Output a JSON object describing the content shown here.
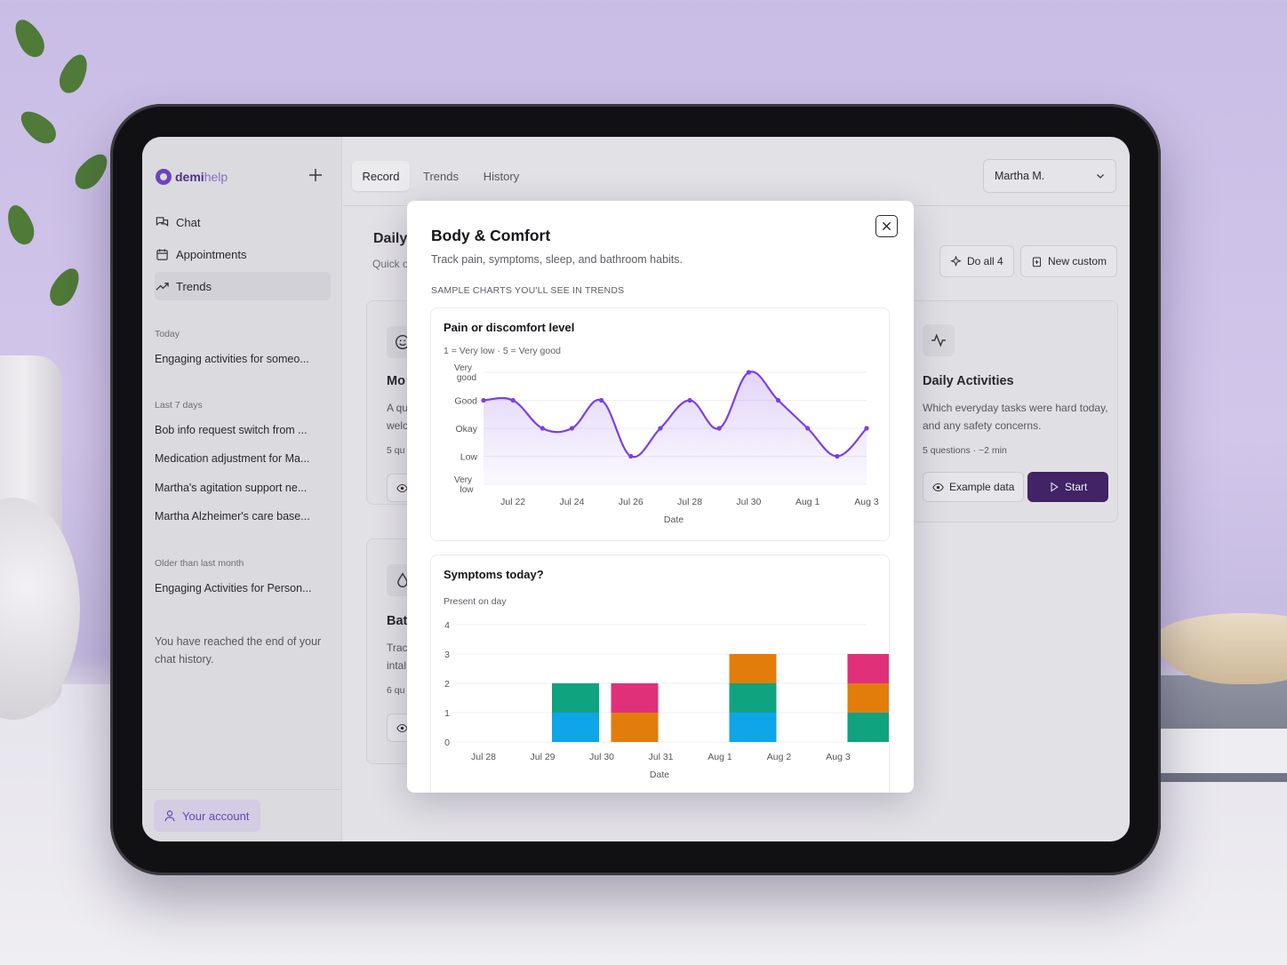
{
  "app": {
    "logo_main": "demi",
    "logo_accent": "help"
  },
  "sidebar": {
    "nav": [
      {
        "label": "Chat",
        "icon": "chat-icon"
      },
      {
        "label": "Appointments",
        "icon": "calendar-icon"
      },
      {
        "label": "Trends",
        "icon": "trend-icon"
      }
    ],
    "sections": [
      {
        "label": "Today",
        "items": [
          "Engaging activities for someo..."
        ]
      },
      {
        "label": "Last 7 days",
        "items": [
          "Bob info request switch from ...",
          "Medication adjustment for Ma...",
          "Martha's agitation support ne...",
          "Martha Alzheimer's care base..."
        ]
      },
      {
        "label": "Older than last month",
        "items": [
          "Engaging Activities for Person..."
        ]
      }
    ],
    "end_note": "You have reached the end of your chat history.",
    "account_label": "Your account"
  },
  "topbar": {
    "tabs": [
      "Record",
      "Trends",
      "History"
    ],
    "active_tab": "Record",
    "user": "Martha M."
  },
  "main": {
    "title_partial": "Daily",
    "subtitle_partial": "Quick o",
    "do_all_label": "Do all 4",
    "new_custom_label": "New custom",
    "cards": {
      "left_top_title": "Mo",
      "left_top_desc": [
        "A qu",
        "welc"
      ],
      "left_top_meta": "5 qu",
      "left_bottom_title": "Bat",
      "left_bottom_desc": [
        "Trac",
        "intal"
      ],
      "left_bottom_meta": "6 qu",
      "daily_activities": {
        "title": "Daily Activities",
        "desc": "Which everyday tasks were hard today, and any safety concerns.",
        "meta": "5 questions · ~2 min",
        "example_label": "Example data",
        "start_label": "Start"
      }
    }
  },
  "modal": {
    "title": "Body & Comfort",
    "subtitle": "Track pain, symptoms, sleep, and bathroom habits.",
    "section_label": "SAMPLE CHARTS YOU'LL SEE IN TRENDS"
  },
  "chart_data": [
    {
      "type": "line",
      "title": "Pain or discomfort level",
      "subtitle": "1 = Very low · 5 = Very good",
      "xlabel": "Date",
      "ylabel": "",
      "ylim": [
        1,
        5
      ],
      "y_tick_labels": [
        {
          "value": 5,
          "label": "Very good"
        },
        {
          "value": 4,
          "label": "Good"
        },
        {
          "value": 3,
          "label": "Okay"
        },
        {
          "value": 2,
          "label": "Low"
        },
        {
          "value": 1,
          "label": "Very low"
        }
      ],
      "x_tick_labels": [
        "Jul 22",
        "Jul 24",
        "Jul 26",
        "Jul 28",
        "Jul 30",
        "Aug 1",
        "Aug 3"
      ],
      "x": [
        "Jul 21",
        "Jul 22",
        "Jul 23",
        "Jul 24",
        "Jul 25",
        "Jul 26",
        "Jul 27",
        "Jul 28",
        "Jul 29",
        "Jul 30",
        "Jul 31",
        "Aug 1",
        "Aug 2",
        "Aug 3"
      ],
      "values": [
        4,
        4,
        3,
        3,
        4,
        2,
        3,
        4,
        3,
        5,
        4,
        3,
        2,
        3
      ],
      "color": "#7b3fe4",
      "grid": true
    },
    {
      "type": "bar",
      "stacked": true,
      "title": "Symptoms today?",
      "subtitle": "Present on day",
      "xlabel": "Date",
      "ylabel": "",
      "ylim": [
        0,
        4
      ],
      "y_ticks": [
        0,
        1,
        2,
        3,
        4
      ],
      "categories": [
        "Jul 28",
        "Jul 29",
        "Jul 30",
        "Jul 31",
        "Aug 1",
        "Aug 2",
        "Aug 3"
      ],
      "series": [
        {
          "color": "#0ea5e9",
          "values": [
            0,
            1,
            0,
            0,
            1,
            0,
            0
          ]
        },
        {
          "color": "#10a37f",
          "values": [
            0,
            1,
            0,
            0,
            1,
            0,
            1
          ]
        },
        {
          "color": "#e27d0c",
          "values": [
            0,
            0,
            1,
            0,
            1,
            0,
            1
          ]
        },
        {
          "color": "#e1307a",
          "values": [
            0,
            0,
            1,
            0,
            0,
            0,
            1
          ]
        }
      ],
      "grid": true
    }
  ],
  "colors": {
    "accent": "#6a3fc4",
    "primary_button": "#3c1a64"
  }
}
